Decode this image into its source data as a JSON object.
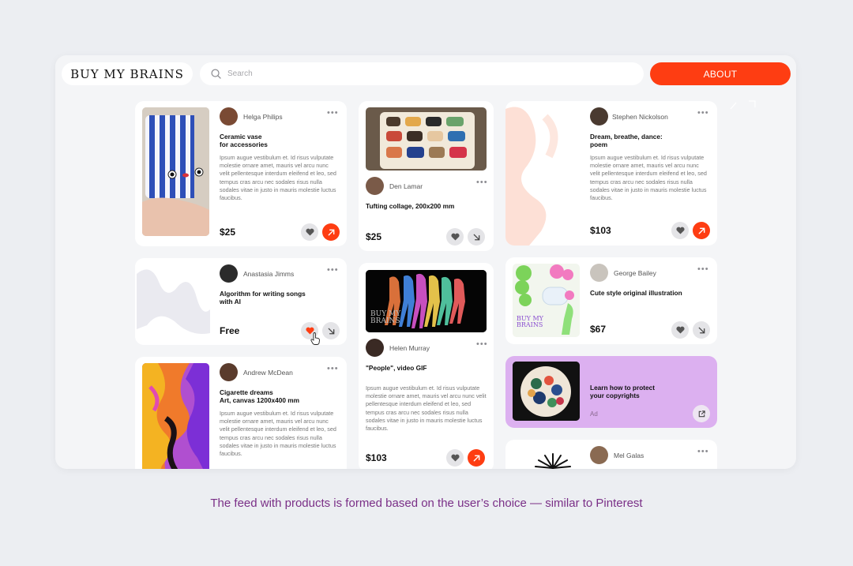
{
  "header": {
    "logo": "BUY MY BRAINS",
    "search_placeholder": "Search",
    "about_label": "ABOUT"
  },
  "cards": {
    "helga": {
      "author": "Helga Philips",
      "title": "Ceramic vase\nfor accessories",
      "desc": "Ipsum augue vestibulum et. Id risus vulputate molestie ornare amet, mauris vel arcu nunc velit pellentesque interdum eleifend et leo, sed tempus cras arcu nec sodales risus nulla sodales vitae in justo in mauris molestie luctus faucibus.",
      "price": "$25"
    },
    "anastasia": {
      "author": "Anastasia Jimms",
      "title": "Algorithm for writing songs\nwith AI",
      "price": "Free"
    },
    "andrew": {
      "author": "Andrew McDean",
      "title": "Cigarette dreams\nArt, canvas 1200x400 mm",
      "desc": "Ipsum augue vestibulum et. Id risus vulputate molestie ornare amet, mauris vel arcu nunc velit pellentesque interdum eleifend et leo, sed tempus cras arcu nec sodales risus nulla sodales vitae in justo in mauris molestie luctus faucibus."
    },
    "den": {
      "author": "Den Lamar",
      "title": "Tufting collage, 200x200 mm",
      "price": "$25"
    },
    "helen": {
      "author": "Helen Murray",
      "title": "\"People\", video GIF",
      "desc": "Ipsum augue vestibulum et. Id risus vulputate molestie ornare amet, mauris vel arcu nunc velit pellentesque interdum eleifend et leo, sed tempus cras arcu nec sodales risus nulla sodales vitae in justo in mauris molestie luctus faucibus.",
      "price": "$103",
      "thumb_text": "BUY MY BRAINS"
    },
    "stephen": {
      "author": "Stephen Nickolson",
      "title": "Dream, breathe, dance:\npoem",
      "desc": "Ipsum augue vestibulum et. Id risus vulputate molestie ornare amet, mauris vel arcu nunc velit pellentesque interdum eleifend et leo, sed tempus cras arcu nec sodales risus nulla sodales vitae in justo in mauris molestie luctus faucibus.",
      "price": "$103"
    },
    "george": {
      "author": "George Bailey",
      "title": "Cute style original illustration",
      "price": "$67",
      "thumb_text": "BUY MY BRAINS"
    },
    "ad": {
      "title": "Learn how to protect\nyour copyrights",
      "label": "Ad"
    },
    "mel": {
      "author": "Mel Galas"
    }
  },
  "dots": "•••",
  "caption": "The feed with products is formed based on the user’s choice — similar to Pinterest",
  "colors": {
    "accent": "#fe3d12",
    "ad_background": "#dcb0f0",
    "caption": "#7a2f87"
  },
  "icons": [
    "search-icon",
    "heart-icon",
    "arrow-up-right-icon",
    "arrow-down-right-icon",
    "external-link-icon",
    "more-icon",
    "cursor-hand-icon"
  ]
}
